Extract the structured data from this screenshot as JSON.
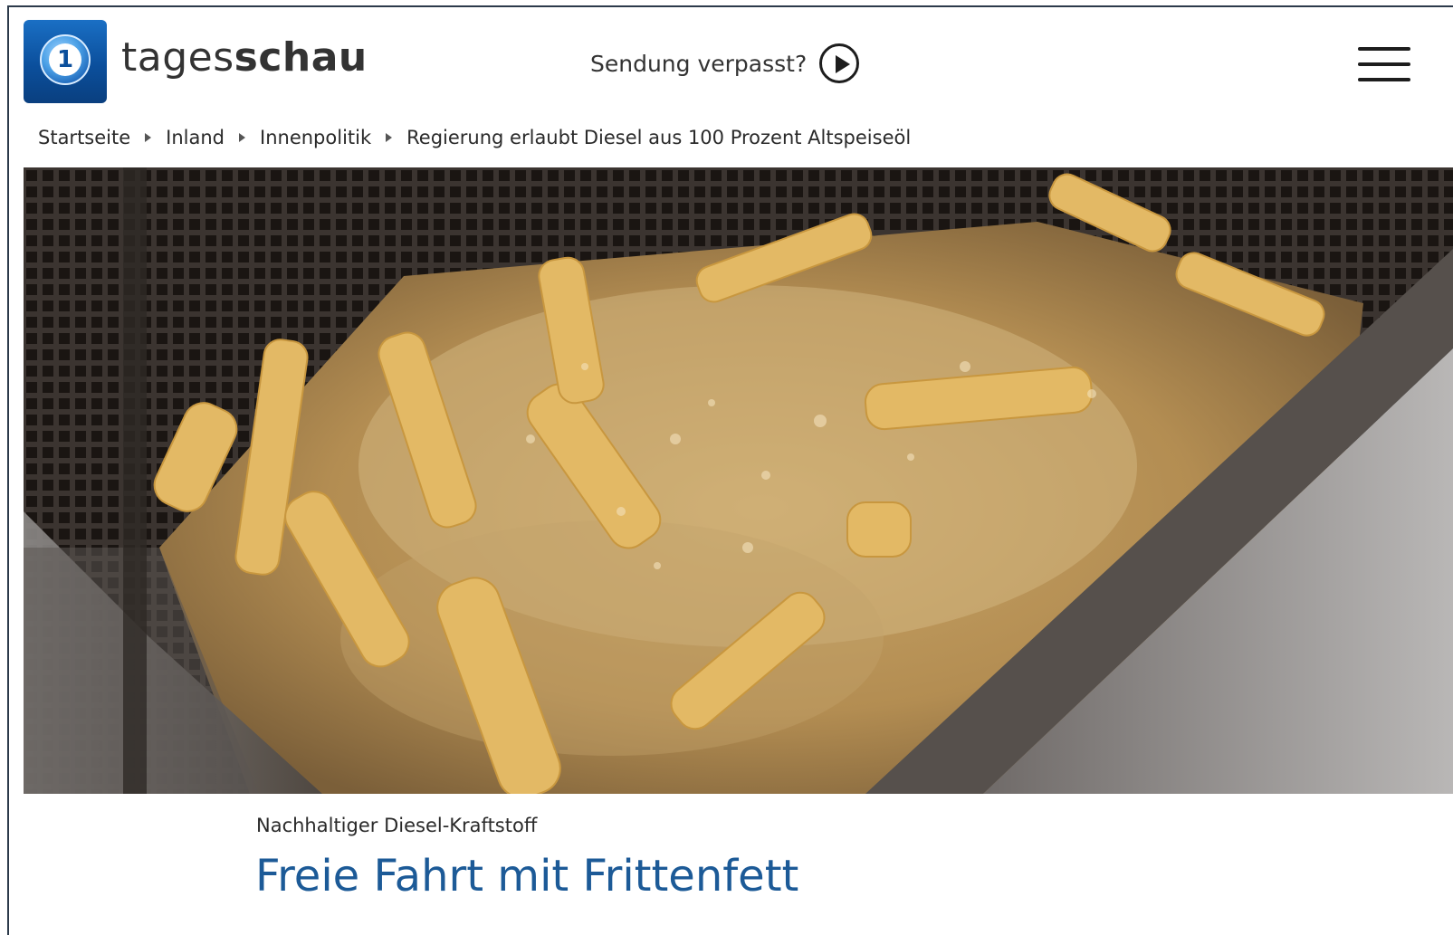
{
  "header": {
    "brand_regular": "tages",
    "brand_bold": "schau",
    "logo_icon": "das-erste-logo-icon",
    "sendung_label": "Sendung verpasst?",
    "play_icon": "play-circle-icon",
    "menu_icon": "hamburger-menu-icon"
  },
  "breadcrumb": {
    "items": [
      "Startseite",
      "Inland",
      "Innenpolitik",
      "Regierung erlaubt Diesel aus 100 Prozent Altspeiseöl"
    ]
  },
  "article": {
    "kicker": "Nachhaltiger Diesel-Kraftstoff",
    "headline": "Freie Fahrt mit Frittenfett"
  },
  "colors": {
    "headline": "#1c5a97",
    "logo_blue": "#0b4f9c"
  }
}
